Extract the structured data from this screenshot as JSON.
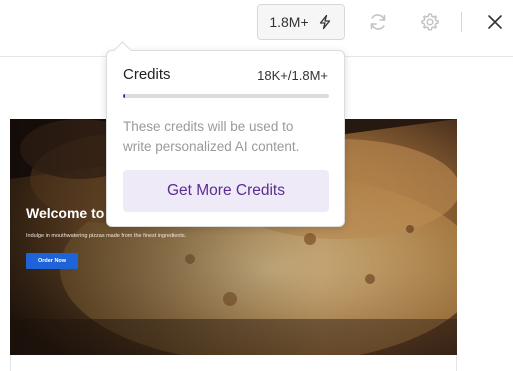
{
  "toolbar": {
    "credits_label": "1.8M+",
    "icons": [
      "lightning-icon",
      "refresh-icon",
      "gear-icon",
      "close-icon"
    ]
  },
  "popover": {
    "title": "Credits",
    "count": "18K+/1.8M+",
    "progress_fraction": 0.01,
    "description": "These credits will be used to write personalized AI content.",
    "button_label": "Get More Credits"
  },
  "preview": {
    "title": "Welcome to",
    "subtitle": "Indulge in mouthwatering pizzas made from the finest ingredients.",
    "button_label": "Order Now"
  },
  "colors": {
    "accent": "#4a3aa6",
    "button_bg": "#efeaf8",
    "button_text": "#5a2d91",
    "hero_button": "#1f63d8"
  }
}
